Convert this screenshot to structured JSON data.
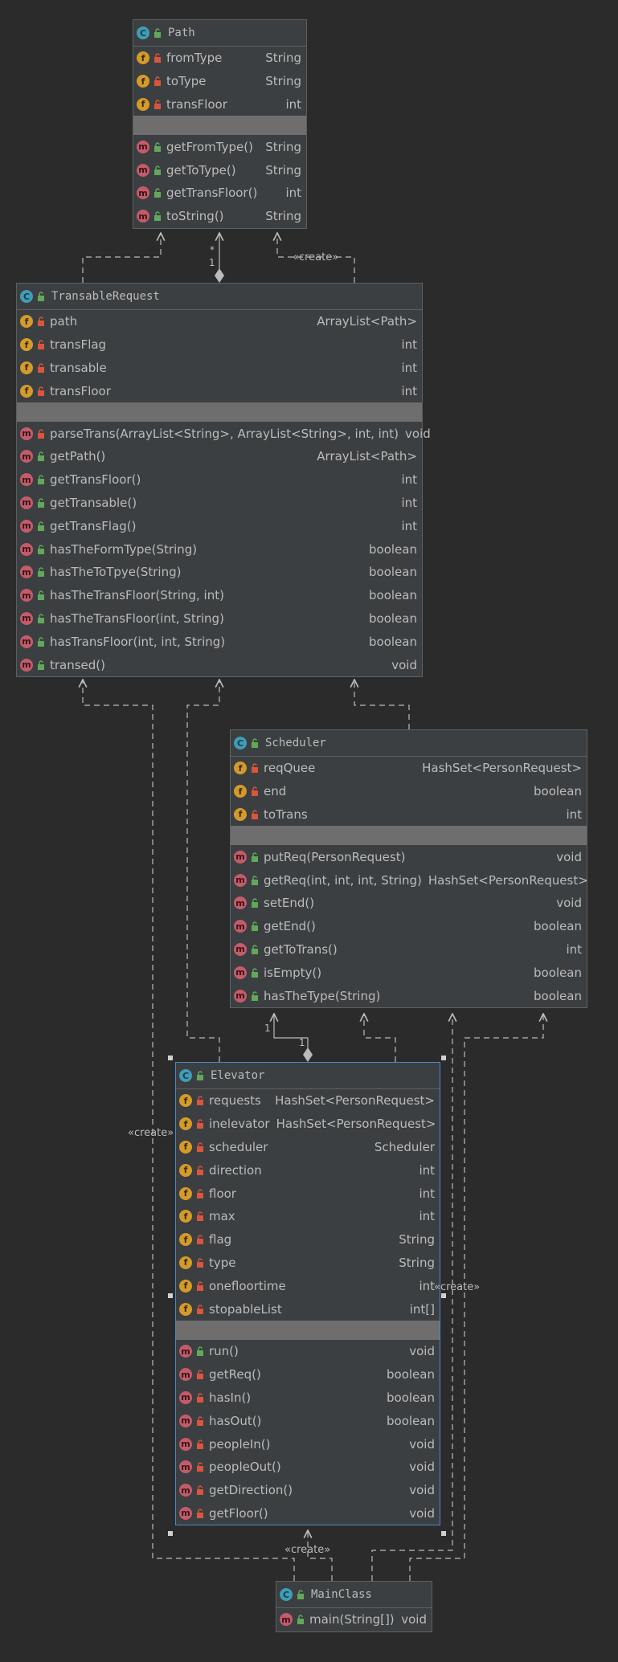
{
  "classes": [
    {
      "key": "path",
      "name": "Path",
      "fields": [
        {
          "name": "fromType",
          "type": "String"
        },
        {
          "name": "toType",
          "type": "String"
        },
        {
          "name": "transFloor",
          "type": "int"
        }
      ],
      "methods": [
        {
          "name": "getFromType()",
          "type": "String",
          "vis": "public"
        },
        {
          "name": "getToType()",
          "type": "String",
          "vis": "public"
        },
        {
          "name": "getTransFloor()",
          "type": "int",
          "vis": "public"
        },
        {
          "name": "toString()",
          "type": "String",
          "vis": "public"
        }
      ]
    },
    {
      "key": "transablerequest",
      "name": "TransableRequest",
      "fields": [
        {
          "name": "path",
          "type": "ArrayList<Path>"
        },
        {
          "name": "transFlag",
          "type": "int"
        },
        {
          "name": "transable",
          "type": "int"
        },
        {
          "name": "transFloor",
          "type": "int"
        }
      ],
      "methods": [
        {
          "name": "parseTrans(ArrayList<String>, ArrayList<String>, int, int)",
          "type": "void",
          "vis": "private"
        },
        {
          "name": "getPath()",
          "type": "ArrayList<Path>",
          "vis": "public"
        },
        {
          "name": "getTransFloor()",
          "type": "int",
          "vis": "public"
        },
        {
          "name": "getTransable()",
          "type": "int",
          "vis": "public"
        },
        {
          "name": "getTransFlag()",
          "type": "int",
          "vis": "public"
        },
        {
          "name": "hasTheFormType(String)",
          "type": "boolean",
          "vis": "public"
        },
        {
          "name": "hasTheToTpye(String)",
          "type": "boolean",
          "vis": "public"
        },
        {
          "name": "hasTheTransFloor(String, int)",
          "type": "boolean",
          "vis": "public"
        },
        {
          "name": "hasTheTransFloor(int, String)",
          "type": "boolean",
          "vis": "public"
        },
        {
          "name": "hasTransFloor(int, int, String)",
          "type": "boolean",
          "vis": "public"
        },
        {
          "name": "transed()",
          "type": "void",
          "vis": "public"
        }
      ]
    },
    {
      "key": "scheduler",
      "name": "Scheduler",
      "fields": [
        {
          "name": "reqQuee",
          "type": "HashSet<PersonRequest>"
        },
        {
          "name": "end",
          "type": "boolean"
        },
        {
          "name": "toTrans",
          "type": "int"
        }
      ],
      "methods": [
        {
          "name": "putReq(PersonRequest)",
          "type": "void",
          "vis": "public"
        },
        {
          "name": "getReq(int, int, int, String)",
          "type": "HashSet<PersonRequest>",
          "vis": "public"
        },
        {
          "name": "setEnd()",
          "type": "void",
          "vis": "public"
        },
        {
          "name": "getEnd()",
          "type": "boolean",
          "vis": "public"
        },
        {
          "name": "getToTrans()",
          "type": "int",
          "vis": "public"
        },
        {
          "name": "isEmpty()",
          "type": "boolean",
          "vis": "public"
        },
        {
          "name": "hasTheType(String)",
          "type": "boolean",
          "vis": "public"
        }
      ]
    },
    {
      "key": "elevator",
      "name": "Elevator",
      "fields": [
        {
          "name": "requests",
          "type": "HashSet<PersonRequest>"
        },
        {
          "name": "inelevator",
          "type": "HashSet<PersonRequest>"
        },
        {
          "name": "scheduler",
          "type": "Scheduler"
        },
        {
          "name": "direction",
          "type": "int"
        },
        {
          "name": "floor",
          "type": "int"
        },
        {
          "name": "max",
          "type": "int"
        },
        {
          "name": "flag",
          "type": "String"
        },
        {
          "name": "type",
          "type": "String"
        },
        {
          "name": "onefloortime",
          "type": "int"
        },
        {
          "name": "stopableList",
          "type": "int[]"
        }
      ],
      "methods": [
        {
          "name": "run()",
          "type": "void",
          "vis": "public"
        },
        {
          "name": "getReq()",
          "type": "boolean",
          "vis": "private"
        },
        {
          "name": "hasIn()",
          "type": "boolean",
          "vis": "private"
        },
        {
          "name": "hasOut()",
          "type": "boolean",
          "vis": "private"
        },
        {
          "name": "peopleIn()",
          "type": "void",
          "vis": "private"
        },
        {
          "name": "peopleOut()",
          "type": "void",
          "vis": "private"
        },
        {
          "name": "getDirection()",
          "type": "void",
          "vis": "private"
        },
        {
          "name": "getFloor()",
          "type": "void",
          "vis": "private"
        }
      ]
    },
    {
      "key": "mainclass",
      "name": "MainClass",
      "fields": [],
      "methods": [
        {
          "name": "main(String[])",
          "type": "void",
          "vis": "public"
        }
      ]
    }
  ],
  "relations": {
    "create_label": "«create»",
    "multiplicity_many": "*",
    "multiplicity_one": "1"
  },
  "icons": {
    "class": "C",
    "field": "f",
    "method": "m"
  },
  "colors": {
    "background": "#2b2b2b",
    "class_fill": "#3c3f41",
    "separator": "#6e6e6e",
    "class_icon": "#3f9db7",
    "field_icon": "#d49b2a",
    "method_icon": "#c35c6a",
    "public_lock": "#62a85a",
    "private_lock": "#d9553e",
    "selection_border": "#4a88c7"
  }
}
